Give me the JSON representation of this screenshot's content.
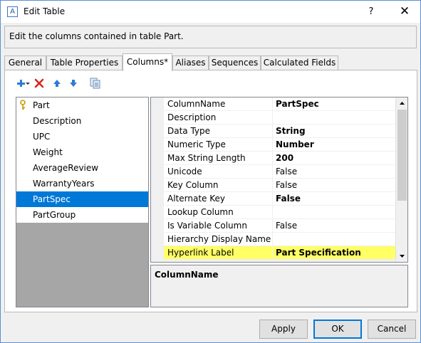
{
  "window": {
    "title": "Edit Table",
    "app_icon_letter": "A",
    "help_label": "?",
    "close_label": "✕"
  },
  "description": "Edit the columns contained in table Part.",
  "tabs": [
    {
      "label": "General"
    },
    {
      "label": "Table Properties"
    },
    {
      "label": "Columns*",
      "active": true
    },
    {
      "label": "Aliases"
    },
    {
      "label": "Sequences"
    },
    {
      "label": "Calculated Fields"
    }
  ],
  "toolbar": {
    "icons": [
      "add-icon",
      "dropdown-arrow-icon",
      "delete-icon",
      "move-up-icon",
      "move-down-icon",
      "copy-icon"
    ]
  },
  "columns": [
    {
      "name": "Part",
      "key": true
    },
    {
      "name": "Description"
    },
    {
      "name": "UPC"
    },
    {
      "name": "Weight"
    },
    {
      "name": "AverageReview"
    },
    {
      "name": "WarrantyYears"
    },
    {
      "name": "PartSpec",
      "selected": true
    },
    {
      "name": "PartGroup"
    }
  ],
  "properties": [
    {
      "name": "ColumnName",
      "value": "PartSpec",
      "bold": true
    },
    {
      "name": "Description",
      "value": ""
    },
    {
      "name": "Data Type",
      "value": "String",
      "bold": true
    },
    {
      "name": "Numeric Type",
      "value": "Number",
      "bold": true
    },
    {
      "name": "Max String Length",
      "value": "200",
      "bold": true
    },
    {
      "name": "Unicode",
      "value": "False"
    },
    {
      "name": "Key Column",
      "value": "False"
    },
    {
      "name": "Alternate Key",
      "value": "False",
      "bold": true
    },
    {
      "name": "Lookup Column",
      "value": ""
    },
    {
      "name": "Is Variable Column",
      "value": "False"
    },
    {
      "name": "Hierarchy Display Name",
      "value": ""
    },
    {
      "name": "Hyperlink Label",
      "value": "Part Specification",
      "bold": true,
      "highlight": true
    }
  ],
  "property_description_title": "ColumnName",
  "buttons": {
    "apply": "Apply",
    "ok": "OK",
    "cancel": "Cancel"
  },
  "colors": {
    "selection": "#0078d7",
    "highlight": "#ffff66",
    "accent": "#5b8fd1"
  }
}
